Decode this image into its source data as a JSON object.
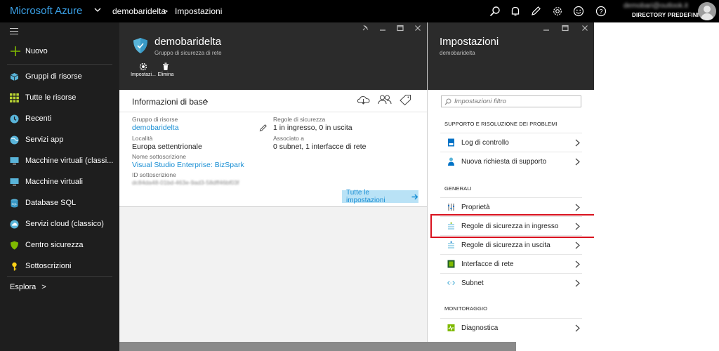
{
  "topbar": {
    "brand": "Microsoft Azure",
    "breadcrumb": [
      "demobaridelta",
      "Impostazioni"
    ],
    "breadcrumb_sep": ">",
    "account_email": "demobari@outlook.it",
    "account_directory": "DIRECTORY PREDEFINITA",
    "icons": [
      "search-icon",
      "bell-icon",
      "pen-icon",
      "gear-icon",
      "smiley-icon",
      "help-icon"
    ]
  },
  "sidebar": {
    "new_label": "Nuovo",
    "items": [
      {
        "label": "Gruppi di risorse",
        "icon": "cube-icon"
      },
      {
        "label": "Tutte le risorse",
        "icon": "grid-icon"
      },
      {
        "label": "Recenti",
        "icon": "clock-icon"
      },
      {
        "label": "Servizi app",
        "icon": "globe-icon"
      },
      {
        "label": "Macchine virtuali (classi...",
        "icon": "monitor-icon"
      },
      {
        "label": "Macchine virtuali",
        "icon": "monitor-icon"
      },
      {
        "label": "Database SQL",
        "icon": "database-icon"
      },
      {
        "label": "Servizi cloud (classico)",
        "icon": "cloud-icon"
      },
      {
        "label": "Centro sicurezza",
        "icon": "shield-icon"
      },
      {
        "label": "Sottoscrizioni",
        "icon": "key-icon"
      }
    ],
    "explore_label": "Esplora",
    "explore_arrow": ">"
  },
  "blade1": {
    "title": "demobaridelta",
    "subtitle": "Gruppo di sicurezza di rete",
    "commands": [
      {
        "label": "Impostazi...",
        "icon": "gear-icon"
      },
      {
        "label": "Elimina",
        "icon": "trash-icon"
      }
    ],
    "essentials": {
      "title": "Informazioni di base",
      "left": [
        {
          "label": "Gruppo di risorse",
          "value": "demobaridelta",
          "link": true
        },
        {
          "label": "Località",
          "value": "Europa settentrionale",
          "link": false
        },
        {
          "label": "Nome sottoscrizione",
          "value": "Visual Studio Enterprise: BizSpark",
          "link": true
        },
        {
          "label": "ID sottoscrizione",
          "value": "dc84da48-01bd-463e-9ad3-58dff46bf03f",
          "link": false
        }
      ],
      "right": [
        {
          "label": "Regole di sicurezza",
          "value": "1 in ingresso, 0 in uscita"
        },
        {
          "label": "Associato a",
          "value": "0 subnet, 1 interfacce di rete"
        }
      ],
      "all_settings": "Tutte le impostazioni"
    }
  },
  "blade2": {
    "title": "Impostazioni",
    "subtitle": "demobaridelta",
    "filter_placeholder": "Impostazioni filtro",
    "sections": [
      {
        "title": "SUPPORTO E RISOLUZIONE DEI PROBLEMI",
        "items": [
          {
            "label": "Log di controllo",
            "icon": "log-icon"
          },
          {
            "label": "Nuova richiesta di supporto",
            "icon": "support-person-icon"
          }
        ]
      },
      {
        "title": "GENERALI",
        "items": [
          {
            "label": "Proprietà",
            "icon": "properties-icon"
          },
          {
            "label": "Regole di sicurezza in ingresso",
            "icon": "inbound-rules-icon"
          },
          {
            "label": "Regole di sicurezza in uscita",
            "icon": "outbound-rules-icon"
          },
          {
            "label": "Interfacce di rete",
            "icon": "network-interface-icon"
          },
          {
            "label": "Subnet",
            "icon": "subnet-icon"
          }
        ]
      },
      {
        "title": "MONITORAGGIO",
        "items": [
          {
            "label": "Diagnostica",
            "icon": "diagnostics-icon"
          }
        ]
      }
    ],
    "highlighted_item": "Regole di sicurezza in ingresso"
  },
  "colors": {
    "accent": "#1a8fd4",
    "brand": "#3aa0e6",
    "highlight": "#d9121f",
    "sidebar_bg": "#1e1e1e",
    "blade_header": "#2b2b2b"
  }
}
